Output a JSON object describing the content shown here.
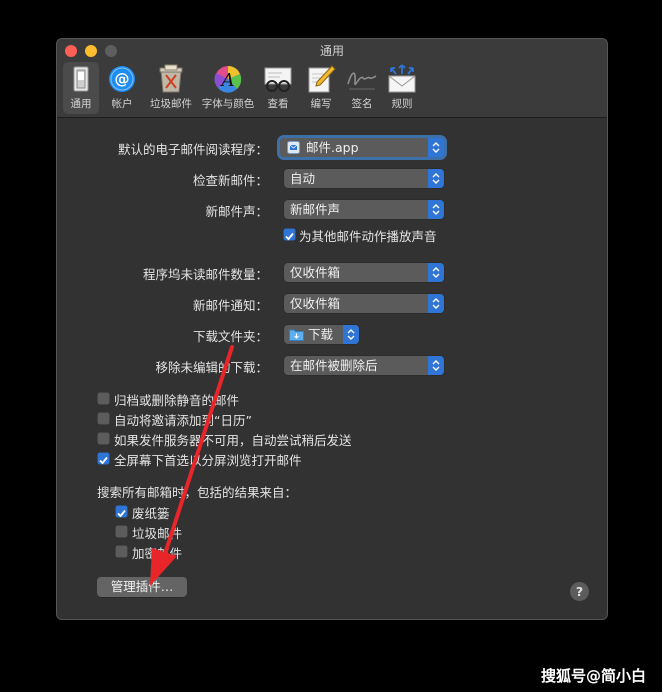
{
  "window": {
    "title": "通用"
  },
  "toolbar": [
    {
      "label": "通用",
      "icon": "general-switch-icon",
      "active": true
    },
    {
      "label": "帐户",
      "icon": "at-sign-icon"
    },
    {
      "label": "垃圾邮件",
      "icon": "junk-bin-icon"
    },
    {
      "label": "字体与颜色",
      "icon": "fonts-colors-icon"
    },
    {
      "label": "查看",
      "icon": "glasses-envelope-icon"
    },
    {
      "label": "编写",
      "icon": "pencil-paper-icon"
    },
    {
      "label": "签名",
      "icon": "signature-icon"
    },
    {
      "label": "规则",
      "icon": "rules-envelope-icon"
    }
  ],
  "settings": {
    "default_reader": {
      "label": "默认的电子邮件阅读程序：",
      "value": "邮件.app"
    },
    "check_new": {
      "label": "检查新邮件：",
      "value": "自动"
    },
    "new_sound": {
      "label": "新邮件声：",
      "value": "新邮件声"
    },
    "play_other_sounds": {
      "label": "为其他邮件动作播放声音",
      "checked": true
    },
    "dock_unread": {
      "label": "程序坞未读邮件数量：",
      "value": "仅收件箱"
    },
    "notifications": {
      "label": "新邮件通知：",
      "value": "仅收件箱"
    },
    "downloads_folder": {
      "label": "下载文件夹：",
      "value": "下载"
    },
    "remove_downloads": {
      "label": "移除未编辑的下载：",
      "value": "在邮件被删除后"
    }
  },
  "options": [
    {
      "label": "归档或删除静音的邮件",
      "checked": false
    },
    {
      "label": "自动将邀请添加到“日历”",
      "checked": false
    },
    {
      "label": "如果发件服务器不可用，自动尝试稍后发送",
      "checked": false
    },
    {
      "label": "全屏幕下首选以分屏浏览打开邮件",
      "checked": true
    }
  ],
  "search": {
    "heading": "搜索所有邮箱时，包括的结果来自：",
    "items": [
      {
        "label": "废纸篓",
        "checked": true
      },
      {
        "label": "垃圾邮件",
        "checked": false
      },
      {
        "label": "加密邮件",
        "checked": false
      }
    ]
  },
  "buttons": {
    "manage_plugins": "管理插件…",
    "help": "?"
  },
  "watermark": "搜狐号@简小白",
  "colors": {
    "accent": "#2f75d6",
    "annotation_arrow": "#e8262a"
  }
}
